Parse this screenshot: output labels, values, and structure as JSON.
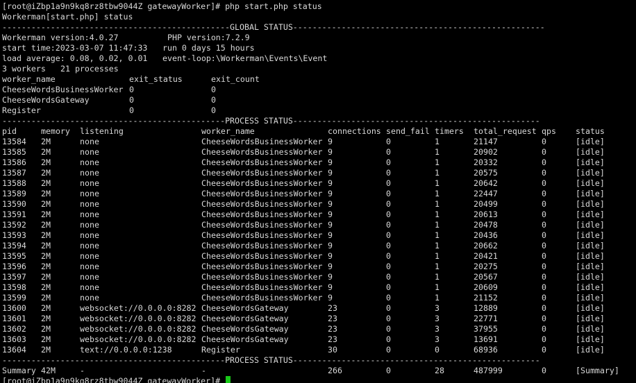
{
  "terminal": {
    "prompt_line": "[root@iZbp1a9n9kq8rz8tbw9044Z gatewayWorker]# php start.php status",
    "echo_line": "Workerman[start.php] status",
    "global_divider": "-----------------------------------------------GLOBAL STATUS----------------------------------------------------",
    "workerman_version": "Workerman version:4.0.27",
    "php_version": "PHP version:7.2.9",
    "start_time": "start time:2023-03-07 11:47:33",
    "run_time": "run 0 days 15 hours",
    "load_average": "load average: 0.08, 0.02, 0.01",
    "event_loop": "event-loop:\\Workerman\\Events\\Event",
    "workers_count": "3 workers",
    "processes_count": "21 processes",
    "worker_headers": [
      "worker_name",
      "exit_status",
      "exit_count"
    ],
    "worker_rows": [
      [
        "CheeseWordsBusinessWorker",
        "0",
        "0"
      ],
      [
        "CheeseWordsGateway",
        "0",
        "0"
      ],
      [
        "Register",
        "0",
        "0"
      ]
    ],
    "process_divider": "----------------------------------------------PROCESS STATUS---------------------------------------------------",
    "process_headers": [
      "pid",
      "memory",
      "listening",
      "worker_name",
      "connections",
      "send_fail",
      "timers",
      "total_request",
      "qps",
      "status"
    ],
    "process_rows": [
      [
        "13584",
        "2M",
        "none",
        "CheeseWordsBusinessWorker",
        "9",
        "0",
        "1",
        "21147",
        "0",
        "[idle]"
      ],
      [
        "13585",
        "2M",
        "none",
        "CheeseWordsBusinessWorker",
        "9",
        "0",
        "1",
        "20902",
        "0",
        "[idle]"
      ],
      [
        "13586",
        "2M",
        "none",
        "CheeseWordsBusinessWorker",
        "9",
        "0",
        "1",
        "20332",
        "0",
        "[idle]"
      ],
      [
        "13587",
        "2M",
        "none",
        "CheeseWordsBusinessWorker",
        "9",
        "0",
        "1",
        "20575",
        "0",
        "[idle]"
      ],
      [
        "13588",
        "2M",
        "none",
        "CheeseWordsBusinessWorker",
        "9",
        "0",
        "1",
        "20642",
        "0",
        "[idle]"
      ],
      [
        "13589",
        "2M",
        "none",
        "CheeseWordsBusinessWorker",
        "9",
        "0",
        "1",
        "22447",
        "0",
        "[idle]"
      ],
      [
        "13590",
        "2M",
        "none",
        "CheeseWordsBusinessWorker",
        "9",
        "0",
        "1",
        "20499",
        "0",
        "[idle]"
      ],
      [
        "13591",
        "2M",
        "none",
        "CheeseWordsBusinessWorker",
        "9",
        "0",
        "1",
        "20613",
        "0",
        "[idle]"
      ],
      [
        "13592",
        "2M",
        "none",
        "CheeseWordsBusinessWorker",
        "9",
        "0",
        "1",
        "20478",
        "0",
        "[idle]"
      ],
      [
        "13593",
        "2M",
        "none",
        "CheeseWordsBusinessWorker",
        "9",
        "0",
        "1",
        "20436",
        "0",
        "[idle]"
      ],
      [
        "13594",
        "2M",
        "none",
        "CheeseWordsBusinessWorker",
        "9",
        "0",
        "1",
        "20662",
        "0",
        "[idle]"
      ],
      [
        "13595",
        "2M",
        "none",
        "CheeseWordsBusinessWorker",
        "9",
        "0",
        "1",
        "20421",
        "0",
        "[idle]"
      ],
      [
        "13596",
        "2M",
        "none",
        "CheeseWordsBusinessWorker",
        "9",
        "0",
        "1",
        "20275",
        "0",
        "[idle]"
      ],
      [
        "13597",
        "2M",
        "none",
        "CheeseWordsBusinessWorker",
        "9",
        "0",
        "1",
        "20567",
        "0",
        "[idle]"
      ],
      [
        "13598",
        "2M",
        "none",
        "CheeseWordsBusinessWorker",
        "9",
        "0",
        "1",
        "20609",
        "0",
        "[idle]"
      ],
      [
        "13599",
        "2M",
        "none",
        "CheeseWordsBusinessWorker",
        "9",
        "0",
        "1",
        "21152",
        "0",
        "[idle]"
      ],
      [
        "13600",
        "2M",
        "websocket://0.0.0.0:8282",
        "CheeseWordsGateway",
        "23",
        "0",
        "3",
        "12889",
        "0",
        "[idle]"
      ],
      [
        "13601",
        "2M",
        "websocket://0.0.0.0:8282",
        "CheeseWordsGateway",
        "23",
        "0",
        "3",
        "22771",
        "0",
        "[idle]"
      ],
      [
        "13602",
        "2M",
        "websocket://0.0.0.0:8282",
        "CheeseWordsGateway",
        "23",
        "0",
        "3",
        "37955",
        "0",
        "[idle]"
      ],
      [
        "13603",
        "2M",
        "websocket://0.0.0.0:8282",
        "CheeseWordsGateway",
        "23",
        "0",
        "3",
        "13691",
        "0",
        "[idle]"
      ],
      [
        "13604",
        "2M",
        "text://0.0.0.0:1238",
        "Register",
        "30",
        "0",
        "0",
        "68936",
        "0",
        "[idle]"
      ]
    ],
    "summary_divider": "----------------------------------------------PROCESS STATUS---------------------------------------------------",
    "summary_row": [
      "Summary",
      "42M",
      "-",
      "-",
      "266",
      "0",
      "28",
      "487999",
      "0",
      "[Summary]"
    ],
    "final_prompt": "[root@iZbp1a9n9kq8rz8tbw9044Z gatewayWorker]# ",
    "colors": {
      "background": "#000000",
      "foreground": "#d9d9d9",
      "cursor": "#19c819"
    }
  }
}
